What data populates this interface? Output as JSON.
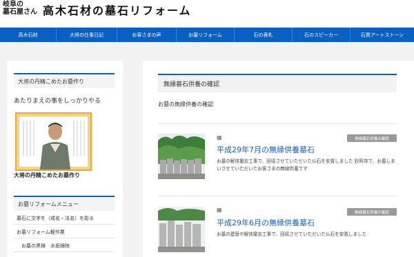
{
  "header": {
    "brand_sub_line1": "岐阜の",
    "brand_sub_line2": "墓石屋さん",
    "brand_title": "高木石材の墓石リフォーム"
  },
  "nav": {
    "items": [
      "高木石材",
      "大将の仕事日記",
      "お客さまの声",
      "お墓リフォーム",
      "石の表札",
      "石のスピーカー",
      "石質アートストーン"
    ]
  },
  "sidebar": {
    "profile_widget_title": "大将の丹精こめたお墓作り",
    "profile_caption": "あたりまえの事をしっかりやる",
    "profile_name": "大将の丹精こめたお墓作り",
    "menu_widget_title": "お墓リフォームメニュー",
    "menu_items": [
      "墓石に文字を（戒名・法名）を彫る",
      "お墓リフォーム軽作業",
      "　お墓の黒掃　水垢掃除"
    ]
  },
  "main": {
    "title": "無縁墓石供養の確認",
    "intro": "お墓の無縁供養の確認",
    "posts": [
      {
        "badge": "無縁墓石供養の確認",
        "title": "平成29年7月の無縁供養墓石",
        "excerpt": "お墓の解体撤去工事で、回収させていただいた仏石を安置しました 妙照寺で、お墓しまいさせていただいたお客さまの無縁供養です"
      },
      {
        "badge": "無縁墓石供養の確認",
        "title": "平成29年6月の無縁供養墓石",
        "excerpt": "お墓の建替や解体撤去工事で、回収させていただいた仏石を安置しました"
      }
    ]
  },
  "colors": {
    "accent": "#0a5fc2",
    "link": "#1a5fb4",
    "badge": "#999999"
  }
}
